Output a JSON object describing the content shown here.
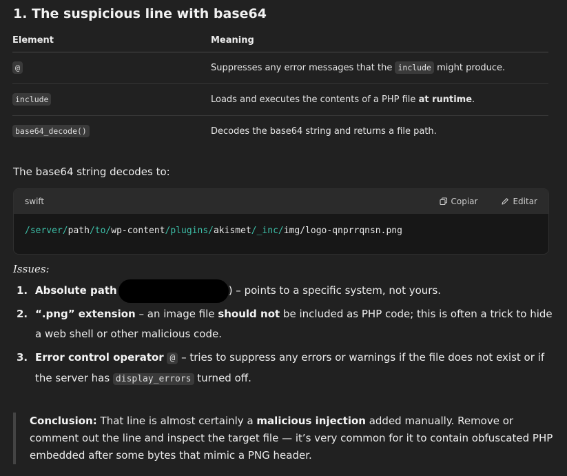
{
  "heading": "1. The suspicious line with base64",
  "table": {
    "headers": [
      "Element",
      "Meaning"
    ],
    "rows": [
      {
        "element": "@",
        "meaning_pre": "Suppresses any error messages that the ",
        "meaning_code": "include",
        "meaning_post": " might produce."
      },
      {
        "element": "include",
        "meaning_pre": "Loads and executes the contents of a PHP file ",
        "meaning_bold": "at runtime",
        "meaning_post": "."
      },
      {
        "element": "base64_decode()",
        "meaning_pre": "Decodes the base64 string and returns a file path.",
        "meaning_post": ""
      }
    ]
  },
  "decodes_text": "The base64 string decodes to:",
  "code_block": {
    "language": "swift",
    "copy_label": "Copiar",
    "edit_label": "Editar",
    "segments": [
      {
        "text": "/server/",
        "class": "teal"
      },
      {
        "text": "path",
        "class": ""
      },
      {
        "text": "/to/",
        "class": "teal"
      },
      {
        "text": "wp-content",
        "class": ""
      },
      {
        "text": "/plugins/",
        "class": "teal"
      },
      {
        "text": "akismet",
        "class": ""
      },
      {
        "text": "/_inc/",
        "class": "teal"
      },
      {
        "text": "img/logo-qnprrqnsn.png",
        "class": ""
      }
    ]
  },
  "issues_label": "Issues:",
  "issues": [
    {
      "num": "1.",
      "bold": "Absolute path",
      "post": ") – points to a specific system, not yours."
    },
    {
      "num": "2.",
      "bold": "“.png” extension",
      "mid": " – an image file ",
      "bold2": "should not",
      "post": " be included as PHP code; this is often a trick to hide a web shell or other malicious code."
    },
    {
      "num": "3.",
      "bold": "Error control operator",
      "code": "@",
      "post": " – tries to suppress any errors or warnings if the file does not exist or if the server has ",
      "code2": "display_errors",
      "post2": " turned off."
    }
  ],
  "conclusion": {
    "label": "Conclusion:",
    "pre": " That line is almost certainly a ",
    "bold": "malicious injection",
    "post": " added manually. Remove or comment out the line and inspect the target file — it’s very common for it to contain obfuscated PHP embedded after some bytes that mimic a PNG header."
  }
}
